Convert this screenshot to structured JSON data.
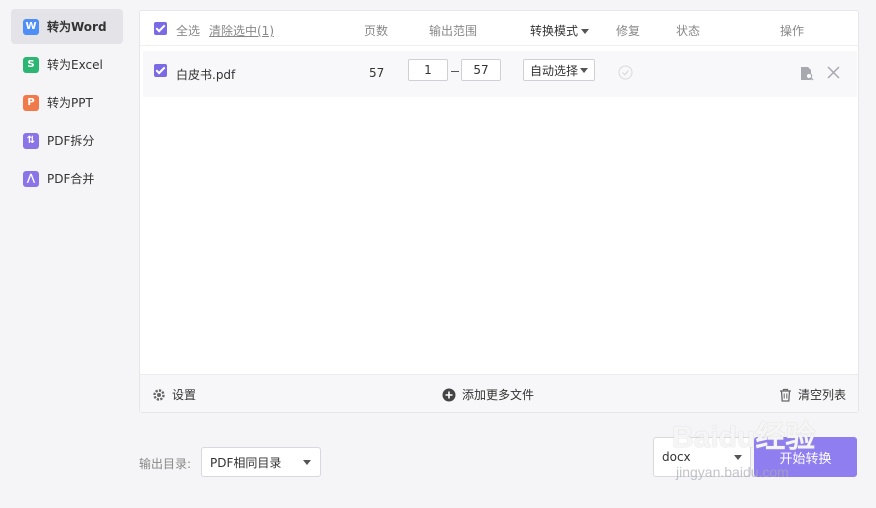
{
  "sidebar": {
    "items": [
      {
        "label": "转为Word",
        "icon": "word-icon",
        "icon_glyph": "W",
        "color": "#4f8ef7",
        "active": true
      },
      {
        "label": "转为Excel",
        "icon": "excel-icon",
        "icon_glyph": "S",
        "color": "#2bb673",
        "active": false
      },
      {
        "label": "转为PPT",
        "icon": "ppt-icon",
        "icon_glyph": "P",
        "color": "#f07a4a",
        "active": false
      },
      {
        "label": "PDF拆分",
        "icon": "split-icon",
        "icon_glyph": "⇅",
        "color": "#8b74e8",
        "active": false
      },
      {
        "label": "PDF合并",
        "icon": "merge-icon",
        "icon_glyph": "⋀",
        "color": "#8b74e8",
        "active": false
      }
    ]
  },
  "table": {
    "header": {
      "select_all": "全选",
      "clear_selection": "清除选中(1)",
      "pages": "页数",
      "output_range": "输出范围",
      "convert_mode": "转换模式",
      "repair": "修复",
      "status": "状态",
      "actions": "操作"
    },
    "rows": [
      {
        "filename": "白皮书.pdf",
        "pages": "57",
        "range_from": "1",
        "range_to": "57",
        "mode": "自动选择"
      }
    ],
    "footer": {
      "settings": "设置",
      "add_files": "添加更多文件",
      "clear_list": "清空列表"
    }
  },
  "output": {
    "dir_label": "输出目录:",
    "dir_value": "PDF相同目录",
    "format": "docx",
    "start_button": "开始转换"
  },
  "watermark": {
    "text": "Baidu经验",
    "sub": "jingyan.baidu.com"
  },
  "colors": {
    "accent": "#8f7ef0",
    "checkbox": "#7a6ae6",
    "link": "#6a7bd8"
  }
}
